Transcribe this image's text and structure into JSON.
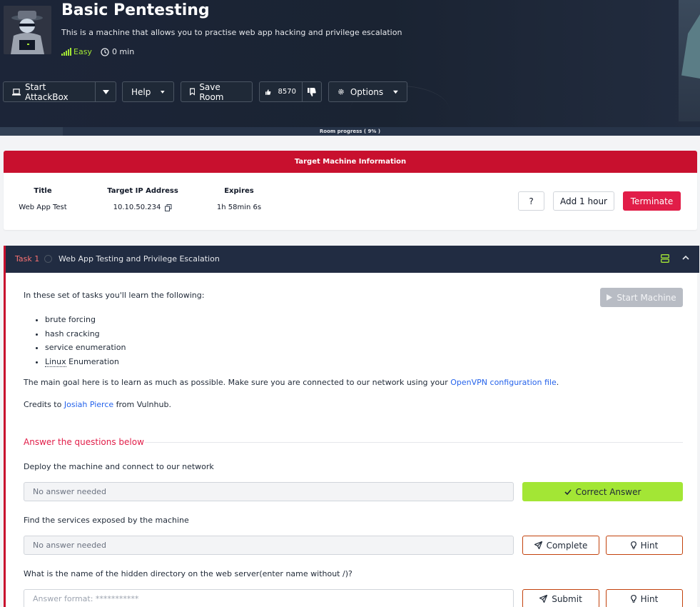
{
  "room": {
    "title": "Basic Pentesting",
    "description": "This is a machine that allows you to practise web app hacking and privilege escalation",
    "difficulty": "Easy",
    "time": "0 min",
    "progress_text": "Room progress ( 9% )",
    "progress_percent": 9
  },
  "toolbar": {
    "start_attackbox": "Start AttackBox",
    "help": "Help",
    "save_room": "Save Room",
    "likes": "8570",
    "options": "Options"
  },
  "target": {
    "header": "Target Machine Information",
    "col_title": "Title",
    "col_ip": "Target IP Address",
    "col_expires": "Expires",
    "title_value": "Web App Test",
    "ip_value": "10.10.50.234",
    "expires_value": "1h 58min 6s",
    "help_btn": "?",
    "add_hour_btn": "Add 1 hour",
    "terminate_btn": "Terminate"
  },
  "task": {
    "label": "Task 1",
    "title": "Web App Testing and Privilege Escalation",
    "start_machine": "Start Machine",
    "intro": "In these set of tasks you'll learn the following:",
    "items": [
      "brute forcing",
      "hash cracking",
      "service enumeration"
    ],
    "item4_linux": "Linux",
    "item4_rest": " Enumeration",
    "goal_prefix": "The main goal here is to learn as much as possible. Make sure you are connected to our network using your ",
    "goal_link": "OpenVPN configuration file",
    "goal_suffix": ".",
    "credits_prefix": "Credits to ",
    "credits_link": "Josiah Pierce",
    "credits_suffix": " from Vulnhub.",
    "answer_header": "Answer the questions below",
    "questions": [
      {
        "text": "Deploy the machine and connect to our network",
        "placeholder": "No answer needed",
        "button": "Correct Answer"
      },
      {
        "text": "Find the services exposed by the machine",
        "placeholder": "No answer needed",
        "button": "Complete",
        "hint": "Hint"
      },
      {
        "text": "What is the name of the hidden directory on the web server(enter name without /)?",
        "placeholder": "Answer format: ***********",
        "button": "Submit",
        "hint": "Hint"
      }
    ]
  },
  "colors": {
    "accent_red": "#c8102e",
    "correct_green": "#a3e635",
    "link_blue": "#2563eb",
    "header_dark": "#212c42"
  }
}
